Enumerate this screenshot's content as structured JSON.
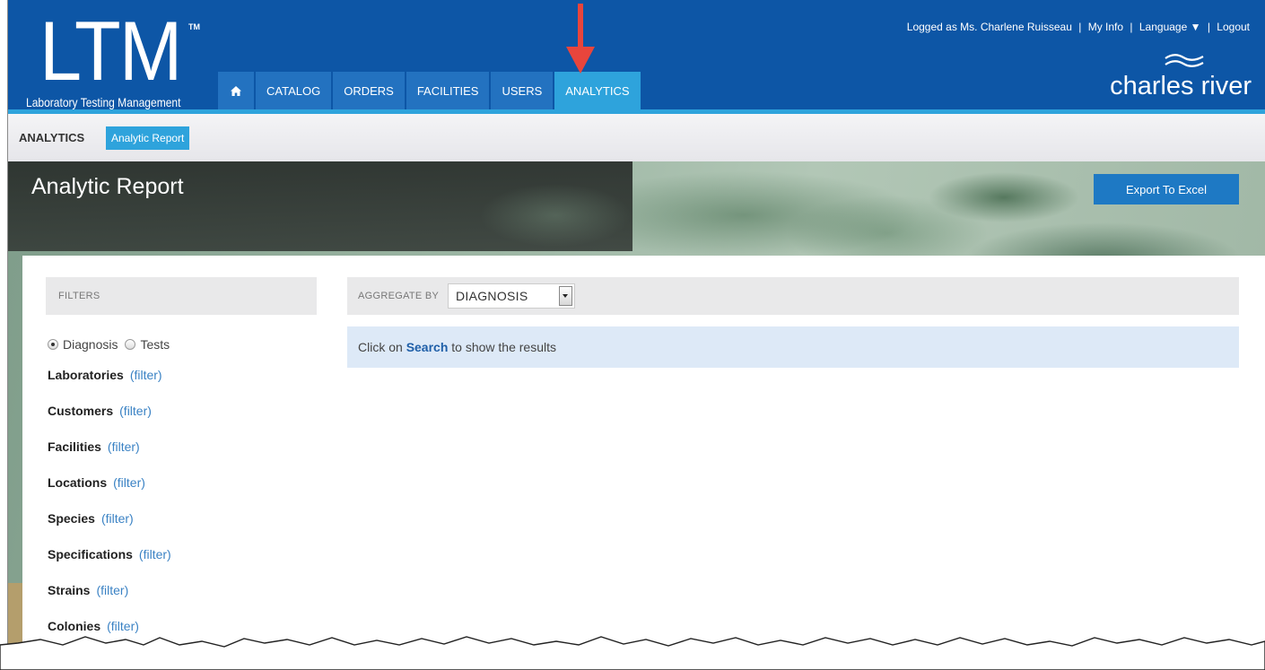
{
  "app": {
    "logo": "LTM",
    "logo_tm": "TM",
    "subtitle": "Laboratory Testing Management",
    "brand": "charles river"
  },
  "nav": {
    "home_icon": "home-icon",
    "items": [
      {
        "label": "CATALOG"
      },
      {
        "label": "ORDERS"
      },
      {
        "label": "FACILITIES"
      },
      {
        "label": "USERS"
      },
      {
        "label": "ANALYTICS",
        "active": true
      }
    ]
  },
  "user_bar": {
    "logged_as": "Logged as Ms. Charlene Ruisseau",
    "sep": "|",
    "my_info": "My Info",
    "language": "Language ▼",
    "logout": "Logout"
  },
  "breadcrumb": {
    "section": "ANALYTICS",
    "item": "Analytic Report"
  },
  "page": {
    "title": "Analytic Report",
    "export_label": "Export To Excel"
  },
  "filters": {
    "header": "FILTERS",
    "radio": [
      {
        "label": "Diagnosis",
        "checked": true
      },
      {
        "label": "Tests",
        "checked": false
      }
    ],
    "filter_link": "(filter)",
    "items": [
      {
        "name": "Laboratories"
      },
      {
        "name": "Customers"
      },
      {
        "name": "Facilities"
      },
      {
        "name": "Locations"
      },
      {
        "name": "Species"
      },
      {
        "name": "Specifications"
      },
      {
        "name": "Strains"
      },
      {
        "name": "Colonies"
      }
    ]
  },
  "aggregate": {
    "label": "AGGREGATE BY",
    "selected": "DIAGNOSIS"
  },
  "results": {
    "prefix": "Click on",
    "search": "Search",
    "suffix": "to show the results"
  },
  "colors": {
    "header_blue": "#0d56a6",
    "accent": "#2ea3dc",
    "arrow_red": "#e8453c"
  }
}
